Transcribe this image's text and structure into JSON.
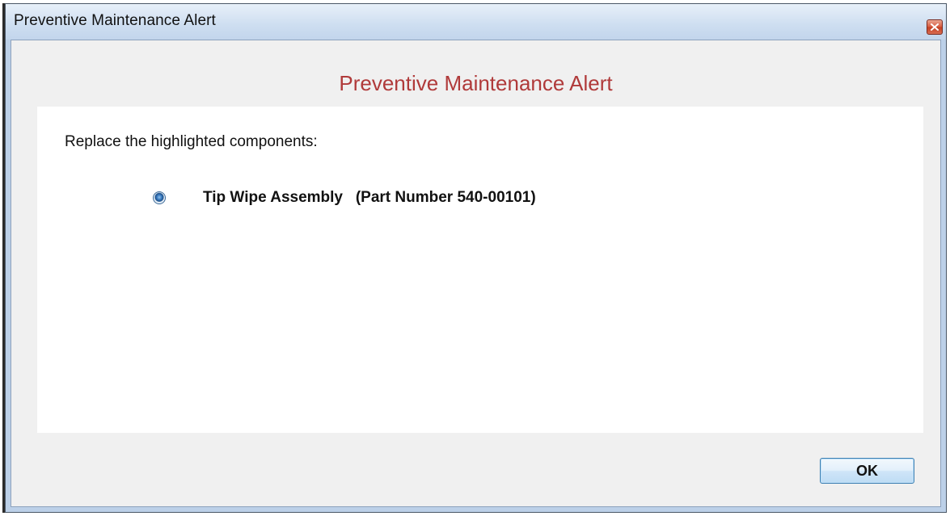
{
  "window": {
    "title": "Preventive Maintenance Alert"
  },
  "dialog": {
    "heading": "Preventive Maintenance Alert",
    "instruction": "Replace the highlighted components:",
    "components": [
      {
        "name": "Tip Wipe Assembly",
        "part_number_text": "(Part Number 540-00101)",
        "selected": true
      }
    ],
    "ok_label": "OK"
  },
  "colors": {
    "heading": "#b03a3a",
    "close_button": "#c33f22",
    "radio_selected": "#1d4f88"
  },
  "icons": {
    "close": "close-icon",
    "radio": "radio-selected-icon"
  }
}
